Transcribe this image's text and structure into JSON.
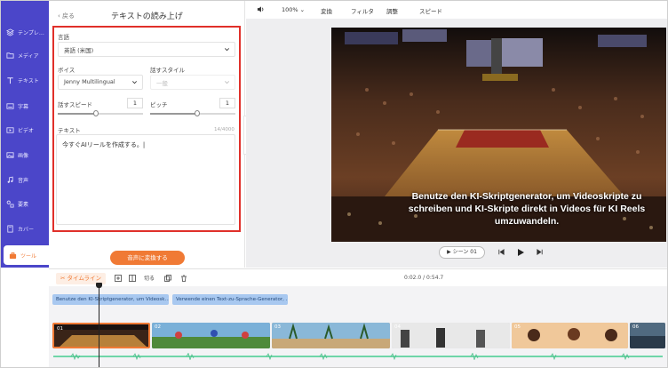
{
  "nav": {
    "items": [
      {
        "label": "テンプレ…",
        "icon": "layers-icon"
      },
      {
        "label": "メディア",
        "icon": "folder-icon"
      },
      {
        "label": "テキスト",
        "icon": "text-icon"
      },
      {
        "label": "字幕",
        "icon": "caption-icon"
      },
      {
        "label": "ビデオ",
        "icon": "video-icon"
      },
      {
        "label": "画像",
        "icon": "image-icon"
      },
      {
        "label": "音声",
        "icon": "music-icon"
      },
      {
        "label": "要素",
        "icon": "elements-icon"
      },
      {
        "label": "カバー",
        "icon": "cover-icon"
      },
      {
        "label": "ツール",
        "icon": "toolbox-icon",
        "active": true
      }
    ]
  },
  "panel": {
    "back": "戻る",
    "title": "テキストの読み上げ",
    "language_label": "言語",
    "language_value": "英語 (米国)",
    "voice_label": "ボイス",
    "voice_value": "Jenny Multilingual",
    "style_label": "話すスタイル",
    "style_value": "一般",
    "speed_label": "話すスピード",
    "speed_value": "1",
    "speed_level": 0.45,
    "pitch_label": "ピッチ",
    "pitch_value": "1",
    "pitch_level": 0.55,
    "text_label": "テキスト",
    "text_counter": "14/4000",
    "text_value": "今すぐAIリールを作成する。",
    "convert_button": "音声に変換する"
  },
  "toolbar": {
    "zoom": "100%",
    "transform": "変換",
    "filter": "フィルタ",
    "adjust": "調整",
    "speed": "スピード"
  },
  "preview": {
    "caption": "Benutze den KI-Skriptgenerator, um Videoskripte zu schreiben und KI-Skripte direkt in Videos für KI Reels umzuwandeln.",
    "scene_button": "シーン 01"
  },
  "timeline": {
    "label": "タイムライン",
    "split_label": "切る",
    "time": "0:02.0 / 0:54.7",
    "text_clips": [
      "Benutze den KI-Skriptgenerator, um Videosk…",
      "Verwende einen Text-zu-Sprache-Generator, …"
    ],
    "clips": [
      "01",
      "02",
      "03",
      "04",
      "05",
      "06"
    ]
  },
  "colors": {
    "nav_bg": "#4b46c9",
    "accent": "#f07a35",
    "highlight_box": "#e0302a",
    "text_clip": "#a8c8f0",
    "waveform": "#6fd6a8"
  }
}
